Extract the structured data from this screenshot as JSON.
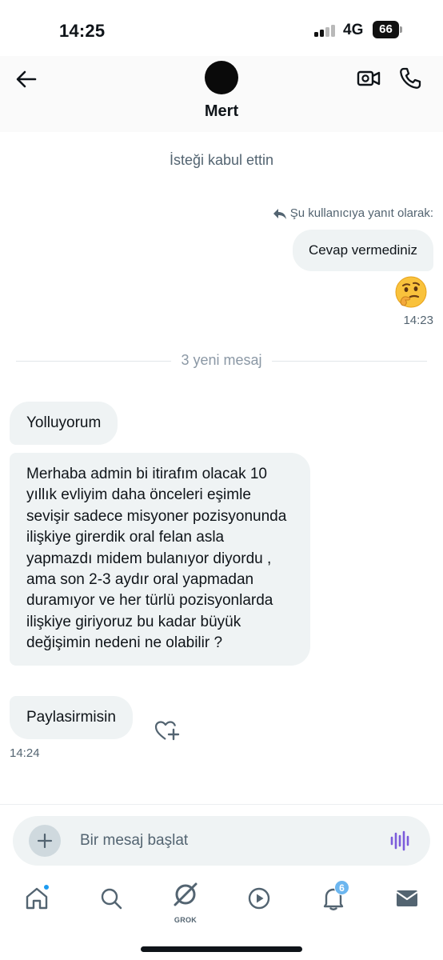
{
  "status_bar": {
    "time": "14:25",
    "network": "4G",
    "battery": "66"
  },
  "header": {
    "contact_name": "Mert",
    "back_icon": "arrow-left-icon",
    "video_icon": "video-camera-icon",
    "phone_icon": "phone-icon"
  },
  "conversation": {
    "system_message": "İsteği kabul ettin",
    "reply_context": "Şu kullanıcıya yanıt olarak:",
    "outgoing": {
      "text": "Cevap vermediniz",
      "reaction": "🤔",
      "time": "14:23"
    },
    "divider": "3 yeni mesaj",
    "incoming": [
      {
        "text": "Yolluyorum"
      },
      {
        "text": "Merhaba admin bi itirafım olacak 10 yıllık evliyim daha önceleri eşimle sevişir sadece misyoner pozisyonunda ilişkiye girerdik oral felan asla yapmazdı midem bulanıyor diyordu , ama son 2-3 aydır oral yapmadan duramıyor ve her türlü pozisyonlarda ilişkiye giriyoruz bu kadar büyük değişimin nedeni ne olabilir ?"
      },
      {
        "text": "Paylasirmisin"
      }
    ],
    "incoming_time": "14:24"
  },
  "composer": {
    "placeholder": "Bir mesaj başlat"
  },
  "bottom_nav": {
    "items": [
      "home-icon",
      "search-icon",
      "grok-icon",
      "play-icon",
      "bell-icon",
      "mail-icon"
    ],
    "grok_label": "GROK",
    "notifications_count": "6"
  },
  "colors": {
    "bubble": "#eff3f4",
    "secondary_text": "#536471",
    "accent": "#1d9bf0",
    "voice": "#7c5cdb"
  }
}
